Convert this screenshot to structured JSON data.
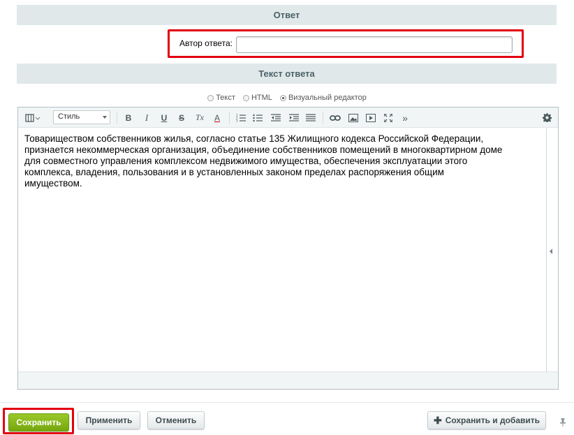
{
  "sections": {
    "answer_title": "Ответ",
    "answer_text_title": "Текст ответа"
  },
  "author": {
    "label": "Автор ответа:",
    "value": ""
  },
  "editor_mode": {
    "options": [
      "Текст",
      "HTML",
      "Визуальный редактор"
    ],
    "selected": "Визуальный редактор"
  },
  "toolbar": {
    "style_select": "Стиль",
    "bold": "B",
    "italic": "I",
    "underline": "U",
    "strike": "S",
    "remove_format": "Tx",
    "font_color": "A",
    "more": "»"
  },
  "editor": {
    "lines": [
      "Товариществом собственников жилья, согласно статье 135 Жилищного кодекса Российской Федерации,",
      "признается некоммерческая организация, объединение собственников помещений в многоквартирном доме",
      "для совместного управления комплексом недвижимого имущества, обеспечения эксплуатации этого",
      "комплекса, владения, пользования и в установленных законом пределах распоряжения общим",
      "имуществом."
    ]
  },
  "buttons": {
    "save": "Сохранить",
    "apply": "Применить",
    "cancel": "Отменить",
    "save_and_add": "Сохранить и добавить"
  },
  "colors": {
    "highlight_border": "#e3000f",
    "save_green": "#8abb1d",
    "header_bg": "#e0e8ea"
  }
}
